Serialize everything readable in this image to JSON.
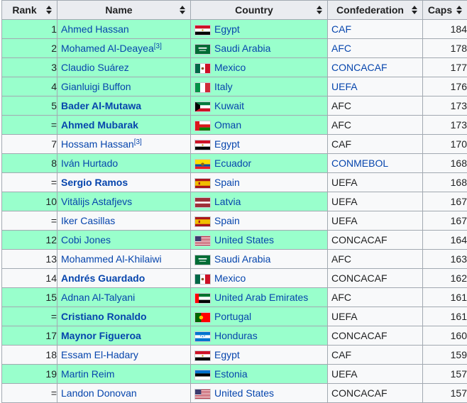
{
  "header": {
    "rank": "Rank",
    "name": "Name",
    "country": "Country",
    "confederation": "Confederation",
    "caps": "Caps"
  },
  "rows": [
    {
      "rank": "1",
      "name": "Ahmed Hassan",
      "ref": "",
      "bold": false,
      "nameHl": true,
      "country": "Egypt",
      "flag": "egypt",
      "confed": "CAF",
      "confedLink": true,
      "caps": "184"
    },
    {
      "rank": "2",
      "name": "Mohamed Al-Deayea",
      "ref": "[3]",
      "bold": false,
      "nameHl": true,
      "country": "Saudi Arabia",
      "flag": "saudi",
      "confed": "AFC",
      "confedLink": true,
      "caps": "178"
    },
    {
      "rank": "3",
      "name": "Claudio Suárez",
      "ref": "",
      "bold": false,
      "nameHl": true,
      "country": "Mexico",
      "flag": "mexico",
      "confed": "CONCACAF",
      "confedLink": true,
      "caps": "177"
    },
    {
      "rank": "4",
      "name": "Gianluigi Buffon",
      "ref": "",
      "bold": false,
      "nameHl": true,
      "country": "Italy",
      "flag": "italy",
      "confed": "UEFA",
      "confedLink": true,
      "caps": "176"
    },
    {
      "rank": "5",
      "name": "Bader Al-Mutawa",
      "ref": "",
      "bold": true,
      "nameHl": true,
      "country": "Kuwait",
      "flag": "kuwait",
      "confed": "AFC",
      "confedLink": false,
      "caps": "173"
    },
    {
      "rank": "=",
      "name": "Ahmed Mubarak",
      "ref": "",
      "bold": true,
      "nameHl": true,
      "country": "Oman",
      "flag": "oman",
      "confed": "AFC",
      "confedLink": false,
      "caps": "173"
    },
    {
      "rank": "7",
      "name": "Hossam Hassan",
      "ref": "[3]",
      "bold": false,
      "nameHl": false,
      "country": "Egypt",
      "flag": "egypt",
      "confed": "CAF",
      "confedLink": false,
      "caps": "170"
    },
    {
      "rank": "8",
      "name": "Iván Hurtado",
      "ref": "",
      "bold": false,
      "nameHl": true,
      "country": "Ecuador",
      "flag": "ecuador",
      "confed": "CONMEBOL",
      "confedLink": true,
      "caps": "168"
    },
    {
      "rank": "=",
      "name": "Sergio Ramos",
      "ref": "",
      "bold": true,
      "nameHl": false,
      "country": "Spain",
      "flag": "spain",
      "confed": "UEFA",
      "confedLink": false,
      "caps": "168"
    },
    {
      "rank": "10",
      "name": "Vitālijs Astafjevs",
      "ref": "",
      "bold": false,
      "nameHl": true,
      "country": "Latvia",
      "flag": "latvia",
      "confed": "UEFA",
      "confedLink": false,
      "caps": "167"
    },
    {
      "rank": "=",
      "name": "Iker Casillas",
      "ref": "",
      "bold": false,
      "nameHl": false,
      "country": "Spain",
      "flag": "spain",
      "confed": "UEFA",
      "confedLink": false,
      "caps": "167"
    },
    {
      "rank": "12",
      "name": "Cobi Jones",
      "ref": "",
      "bold": false,
      "nameHl": true,
      "country": "United States",
      "flag": "usa",
      "confed": "CONCACAF",
      "confedLink": false,
      "caps": "164"
    },
    {
      "rank": "13",
      "name": "Mohammed Al-Khilaiwi",
      "ref": "",
      "bold": false,
      "nameHl": false,
      "country": "Saudi Arabia",
      "flag": "saudi",
      "confed": "AFC",
      "confedLink": false,
      "caps": "163"
    },
    {
      "rank": "14",
      "name": "Andrés Guardado",
      "ref": "",
      "bold": true,
      "nameHl": false,
      "country": "Mexico",
      "flag": "mexico",
      "confed": "CONCACAF",
      "confedLink": false,
      "caps": "162"
    },
    {
      "rank": "15",
      "name": "Adnan Al-Talyani",
      "ref": "",
      "bold": false,
      "nameHl": true,
      "country": "United Arab Emirates",
      "flag": "uae",
      "confed": "AFC",
      "confedLink": false,
      "caps": "161"
    },
    {
      "rank": "=",
      "name": "Cristiano Ronaldo",
      "ref": "",
      "bold": true,
      "nameHl": true,
      "country": "Portugal",
      "flag": "portugal",
      "confed": "UEFA",
      "confedLink": false,
      "caps": "161"
    },
    {
      "rank": "17",
      "name": "Maynor Figueroa",
      "ref": "",
      "bold": true,
      "nameHl": true,
      "country": "Honduras",
      "flag": "honduras",
      "confed": "CONCACAF",
      "confedLink": false,
      "caps": "160"
    },
    {
      "rank": "18",
      "name": "Essam El-Hadary",
      "ref": "",
      "bold": false,
      "nameHl": false,
      "country": "Egypt",
      "flag": "egypt",
      "confed": "CAF",
      "confedLink": false,
      "caps": "159"
    },
    {
      "rank": "19",
      "name": "Martin Reim",
      "ref": "",
      "bold": false,
      "nameHl": true,
      "country": "Estonia",
      "flag": "estonia",
      "confed": "UEFA",
      "confedLink": false,
      "caps": "157"
    },
    {
      "rank": "=",
      "name": "Landon Donovan",
      "ref": "",
      "bold": false,
      "nameHl": false,
      "country": "United States",
      "flag": "usa",
      "confed": "CONCACAF",
      "confedLink": false,
      "caps": "157"
    }
  ],
  "colors": {
    "highlight": "#99ffcc",
    "link": "#0645ad",
    "headerBg": "#eaecf0",
    "border": "#a2a9b1"
  }
}
